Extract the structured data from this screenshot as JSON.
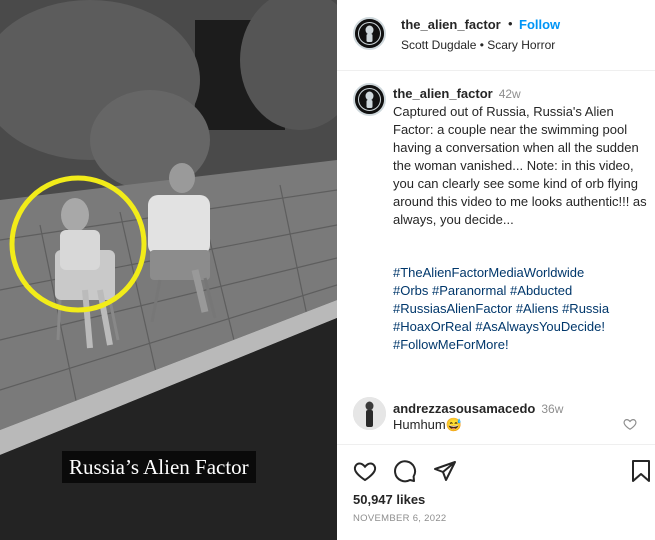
{
  "video": {
    "overlay_caption": "Russia’s Alien Factor",
    "highlight_color": "#f2ec19"
  },
  "header": {
    "username": "the_alien_factor",
    "separator": "•",
    "follow_label": "Follow",
    "subtitle": "Scott Dugdale • Scary Horror"
  },
  "post": {
    "username": "the_alien_factor",
    "time": "42w",
    "caption": "Captured out of Russia, Russia's Alien Factor: a couple near the swimming pool having a conversation when all the sudden the woman vanished... Note: in this video, you can clearly see some kind of orb flying around this video to me looks authentic!!! as always, you decide...",
    "hashtags": [
      "#TheAlienFactorMediaWorldwide",
      "#Orbs #Paranormal #Abducted",
      "#RussiasAlienFactor #Aliens #Russia",
      "#HoaxOrReal #AsAlwaysYouDecide!",
      "#FollowMeForMore!"
    ]
  },
  "reply": {
    "username": "andrezzasousamacedo",
    "time": "36w",
    "text": "Humhum😅"
  },
  "actions": {
    "icons": [
      "heart-icon",
      "comment-icon",
      "share-icon",
      "bookmark-icon"
    ]
  },
  "likes": "50,947 likes",
  "date": "NOVEMBER 6, 2022",
  "colors": {
    "link": "#00376b",
    "follow": "#0095f6",
    "muted": "#8e8e8e"
  }
}
